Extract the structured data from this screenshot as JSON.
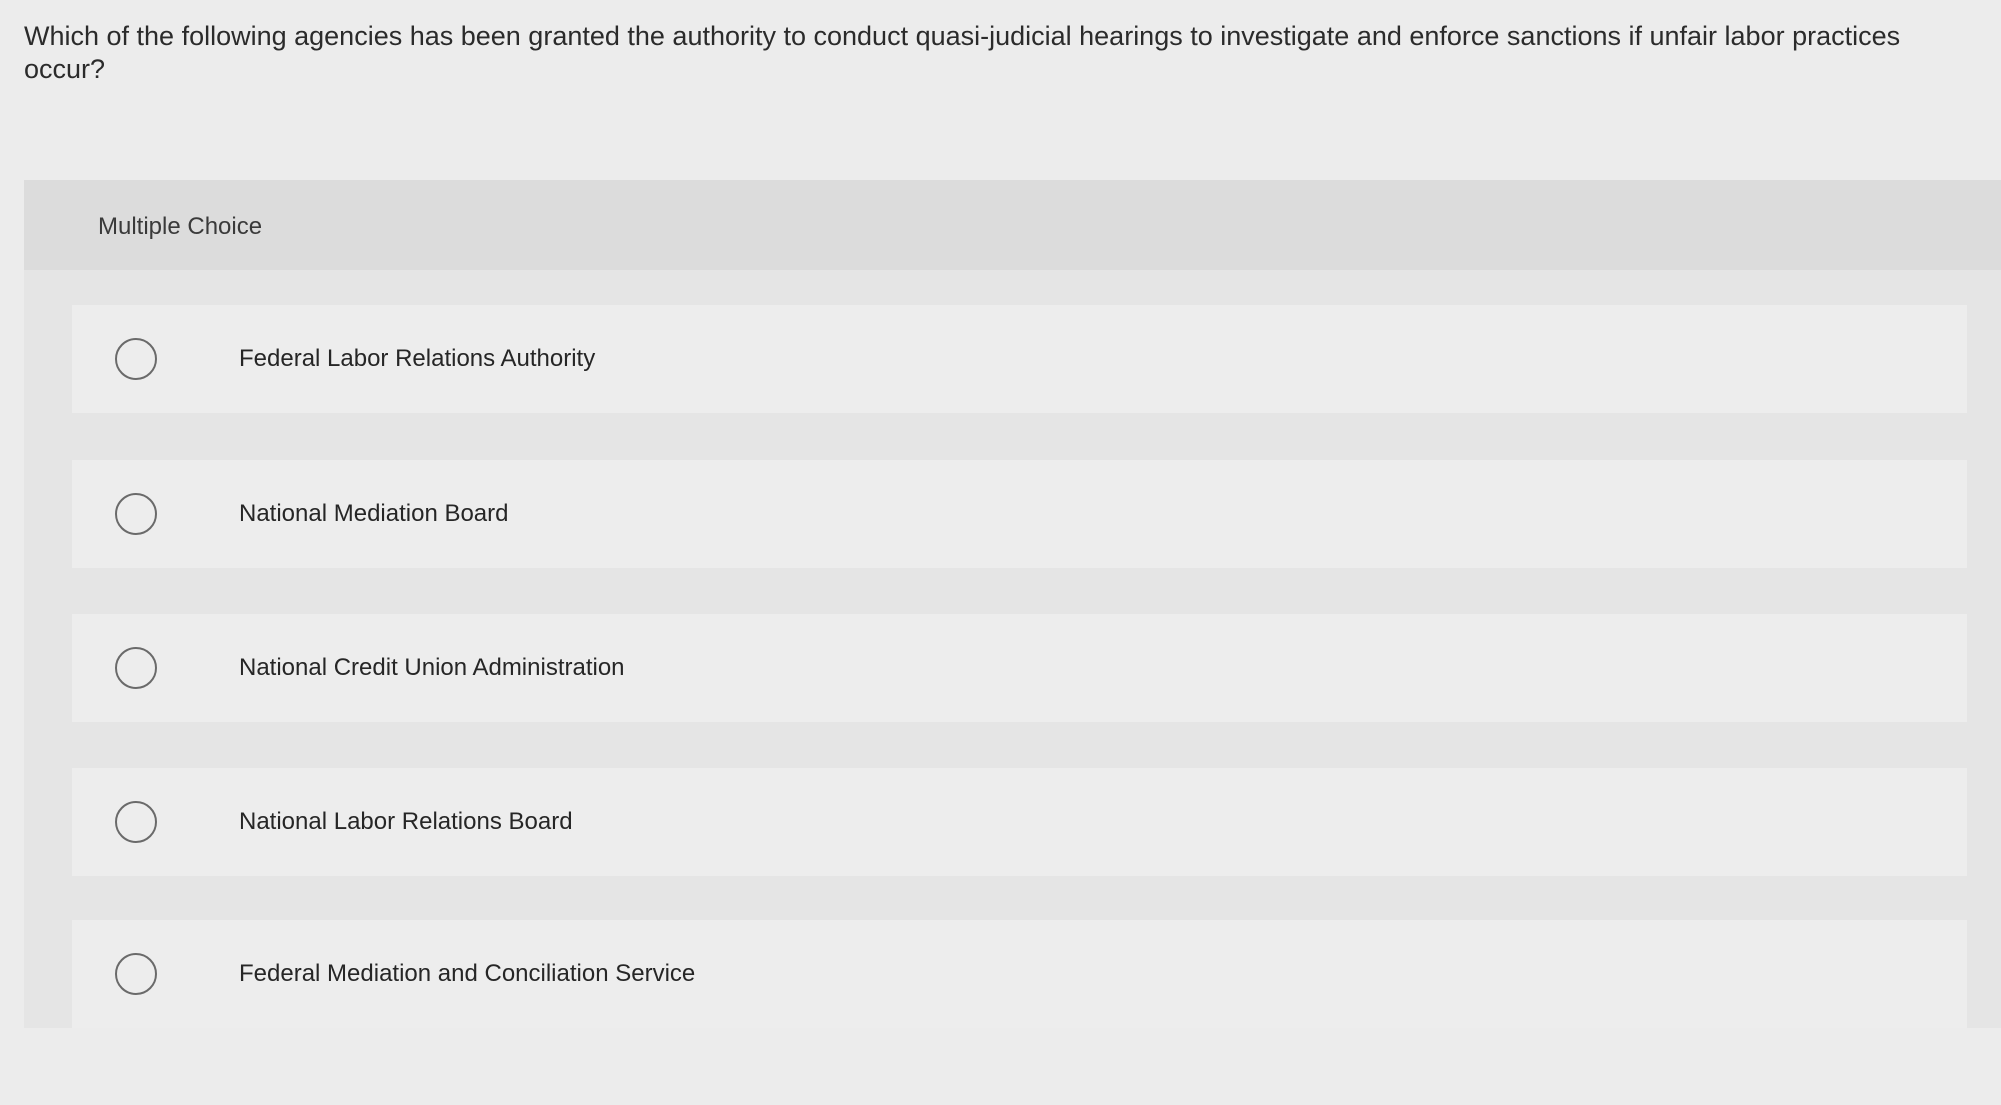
{
  "question": {
    "text": "Which of the following agencies has been granted the authority to conduct quasi-judicial hearings to investigate and enforce sanctions if unfair labor practices occur?"
  },
  "panel": {
    "label": "Multiple Choice"
  },
  "options": [
    {
      "label": "Federal Labor Relations Authority",
      "selected": false
    },
    {
      "label": "National Mediation Board",
      "selected": false
    },
    {
      "label": "National Credit Union Administration",
      "selected": false
    },
    {
      "label": "National Labor Relations Board",
      "selected": false
    },
    {
      "label": "Federal Mediation and Conciliation Service",
      "selected": false
    }
  ]
}
